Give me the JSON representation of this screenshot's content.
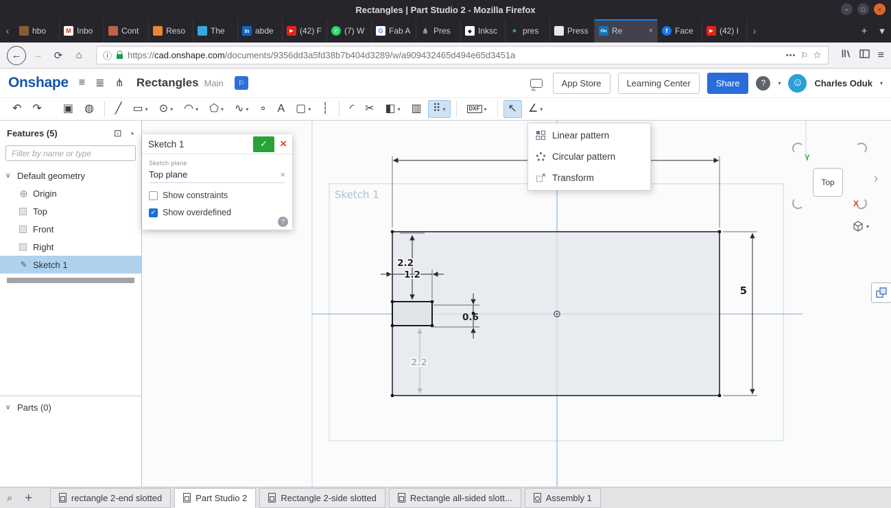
{
  "ui": {
    "minimize": "−",
    "maximize": "□",
    "close": "×",
    "scroll_left": "‹",
    "scroll_right": "›",
    "plus": "+",
    "list_caret": "▾",
    "back": "←",
    "forward": "→",
    "reload": "⟳",
    "home": "⌂",
    "info": "ⓘ",
    "dots": "•••",
    "flag": "⚐",
    "star": "☆",
    "menu": "≡",
    "list_icon": "≣",
    "branch_icon": "⋔",
    "smiley": "☺",
    "help": "?",
    "caret_down": "▾",
    "chevron_down": "∨",
    "clock": "◔",
    "display": "⊡",
    "origin": "◎",
    "pencil": "✎",
    "x_small": "×",
    "check": "✓",
    "search": "⌕"
  },
  "titlebar": {
    "title": "Rectangles | Part Studio 2 - Mozilla Firefox"
  },
  "tabstrip": {
    "tabs": [
      {
        "label": "hbo",
        "icon_glyph": "",
        "icon_style": "background:#8a5a35;color:#fff"
      },
      {
        "label": "Inbo",
        "icon_glyph": "M",
        "icon_style": "background:#fff;color:#d93025"
      },
      {
        "label": "Cont",
        "icon_glyph": "",
        "icon_style": "background:#c0614a;color:#fff"
      },
      {
        "label": "Reso",
        "icon_glyph": "",
        "icon_style": "background:#e8872d;color:#fff"
      },
      {
        "label": "The",
        "icon_glyph": "",
        "icon_style": "background:#35a8dc;color:#fff"
      },
      {
        "label": "abde",
        "icon_glyph": "in",
        "icon_style": "background:#0a66c2;color:#fff;font-size:8px"
      },
      {
        "label": "(42) F",
        "icon_glyph": "▶",
        "icon_style": "background:#e62117;color:#fff;font-size:7px"
      },
      {
        "label": "(7) W",
        "icon_glyph": "✆",
        "icon_style": "background:#25d366;color:#fff;border-radius:50%;font-size:8px"
      },
      {
        "label": "Fab A",
        "icon_glyph": "G",
        "icon_style": "background:#fff;color:#4285f4"
      },
      {
        "label": "Pres",
        "icon_glyph": "⋔",
        "icon_style": "background:transparent;color:#c9c9cf;font-size:11px"
      },
      {
        "label": "Inksc",
        "icon_glyph": "◆",
        "icon_style": "background:#fff;color:#26262b;font-size:8px"
      },
      {
        "label": "pres",
        "icon_glyph": "●",
        "icon_style": "background:transparent;color:#3aa75c;font-size:11px"
      },
      {
        "label": "Press Fi",
        "icon_glyph": "",
        "icon_style": "background:#e8e8ec;color:#555"
      },
      {
        "label": "Re",
        "icon_glyph": "On",
        "icon_style": "background:#0b76bc;color:#fff;font-size:6.5px"
      },
      {
        "label": "Face",
        "icon_glyph": "f",
        "icon_style": "background:#1877f2;color:#fff;border-radius:50%"
      },
      {
        "label": "(42) I",
        "icon_glyph": "▶",
        "icon_style": "background:#e62117;color:#fff;font-size:7px"
      }
    ]
  },
  "navbar": {
    "url_prefix": "https://",
    "url_host": "cad.onshape.com",
    "url_path": "/documents/9356dd3a5fd38b7b404d3289/w/a909432465d494e65d3451a"
  },
  "header": {
    "logo": "Onshape",
    "document_title": "Rectangles",
    "workspace": "Main",
    "app_store_label": "App Store",
    "learning_center_label": "Learning Center",
    "share_label": "Share",
    "user_name": "Charles Oduk"
  },
  "toolbar": {
    "items": [
      {
        "name": "undo",
        "glyph": "↶"
      },
      {
        "name": "redo",
        "glyph": "↷"
      },
      {
        "name": "copy",
        "glyph": "▣"
      },
      {
        "name": "use-project",
        "glyph": "◍"
      },
      {
        "name": "line",
        "glyph": "╱"
      },
      {
        "name": "rectangle",
        "glyph": "▭"
      },
      {
        "name": "circle",
        "glyph": "⊙"
      },
      {
        "name": "arc",
        "glyph": "◠"
      },
      {
        "name": "polygon",
        "glyph": "⬠"
      },
      {
        "name": "spline",
        "glyph": "∿"
      },
      {
        "name": "point",
        "glyph": "∘"
      },
      {
        "name": "text",
        "glyph": "A"
      },
      {
        "name": "slot",
        "glyph": "▢"
      },
      {
        "name": "construction",
        "glyph": "┆"
      },
      {
        "name": "fillet",
        "glyph": "◜"
      },
      {
        "name": "trim",
        "glyph": "✂"
      },
      {
        "name": "mirror",
        "glyph": "◧"
      },
      {
        "name": "inspect",
        "glyph": "▥"
      },
      {
        "name": "pattern",
        "glyph": "⠿"
      },
      {
        "name": "dxf",
        "glyph": "DXF"
      },
      {
        "name": "transform-arrow",
        "glyph": "↖"
      },
      {
        "name": "dimension",
        "glyph": "∠"
      }
    ]
  },
  "pattern_menu": {
    "items": [
      {
        "label": "Linear pattern"
      },
      {
        "label": "Circular pattern"
      },
      {
        "label": "Transform"
      }
    ]
  },
  "features": {
    "title": "Features (5)",
    "filter_placeholder": "Filter by name or type",
    "group_label": "Default geometry",
    "items": [
      {
        "label": "Origin"
      },
      {
        "label": "Top"
      },
      {
        "label": "Front"
      },
      {
        "label": "Right"
      },
      {
        "label": "Sketch 1"
      }
    ],
    "parts_label": "Parts (0)"
  },
  "sketch_dialog": {
    "title": "Sketch 1",
    "plane_label": "Sketch plane",
    "plane_value": "Top plane",
    "show_constraints_label": "Show constraints",
    "show_overdefined_label": "Show overdefined",
    "constraints_checked": false,
    "overdefined_checked": true
  },
  "canvas": {
    "sketch_label": "Sketch 1",
    "dimensions": {
      "height": "5",
      "top_offset": "2.2",
      "slot_width": "1.2",
      "slot_height": "0.6",
      "bottom_offset": "2.2"
    },
    "viewcube": {
      "face": "Top",
      "x": "X",
      "y": "Y"
    }
  },
  "bottom_tabs": {
    "tabs": [
      {
        "label": "rectangle 2-end slotted"
      },
      {
        "label": "Part Studio 2"
      },
      {
        "label": "Rectangle 2-side slotted"
      },
      {
        "label": "Rectangle all-sided slott..."
      },
      {
        "label": "Assembly 1"
      }
    ]
  }
}
